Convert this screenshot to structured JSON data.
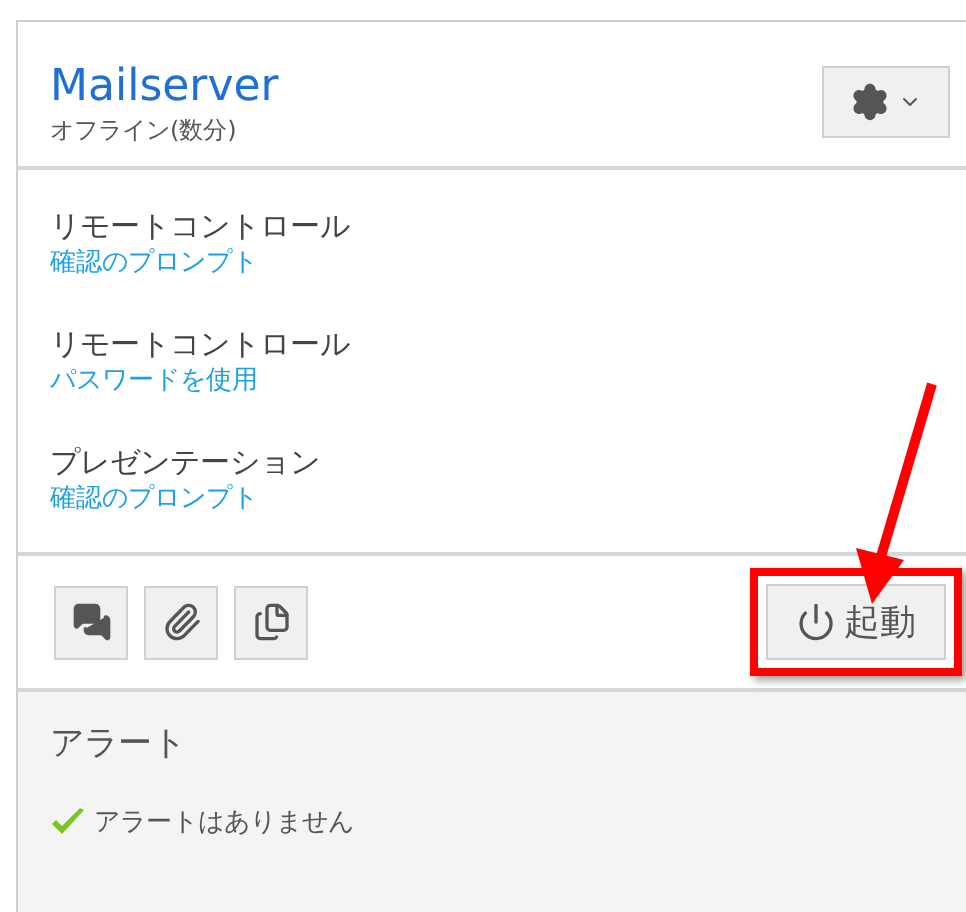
{
  "header": {
    "title": "Mailserver",
    "status": "オフライン(数分)"
  },
  "permissions": [
    {
      "name": "リモートコントロール",
      "value": "確認のプロンプト"
    },
    {
      "name": "リモートコントロール",
      "value": "パスワードを使用"
    },
    {
      "name": "プレゼンテーション",
      "value": "確認のプロンプト"
    }
  ],
  "toolbar": {
    "tools": [
      {
        "kind": "chat"
      },
      {
        "kind": "attach"
      },
      {
        "kind": "notes"
      }
    ],
    "start_button": {
      "label": "起動",
      "highlighted": true
    }
  },
  "alerts": {
    "title": "アラート",
    "message": "アラートはありません"
  }
}
